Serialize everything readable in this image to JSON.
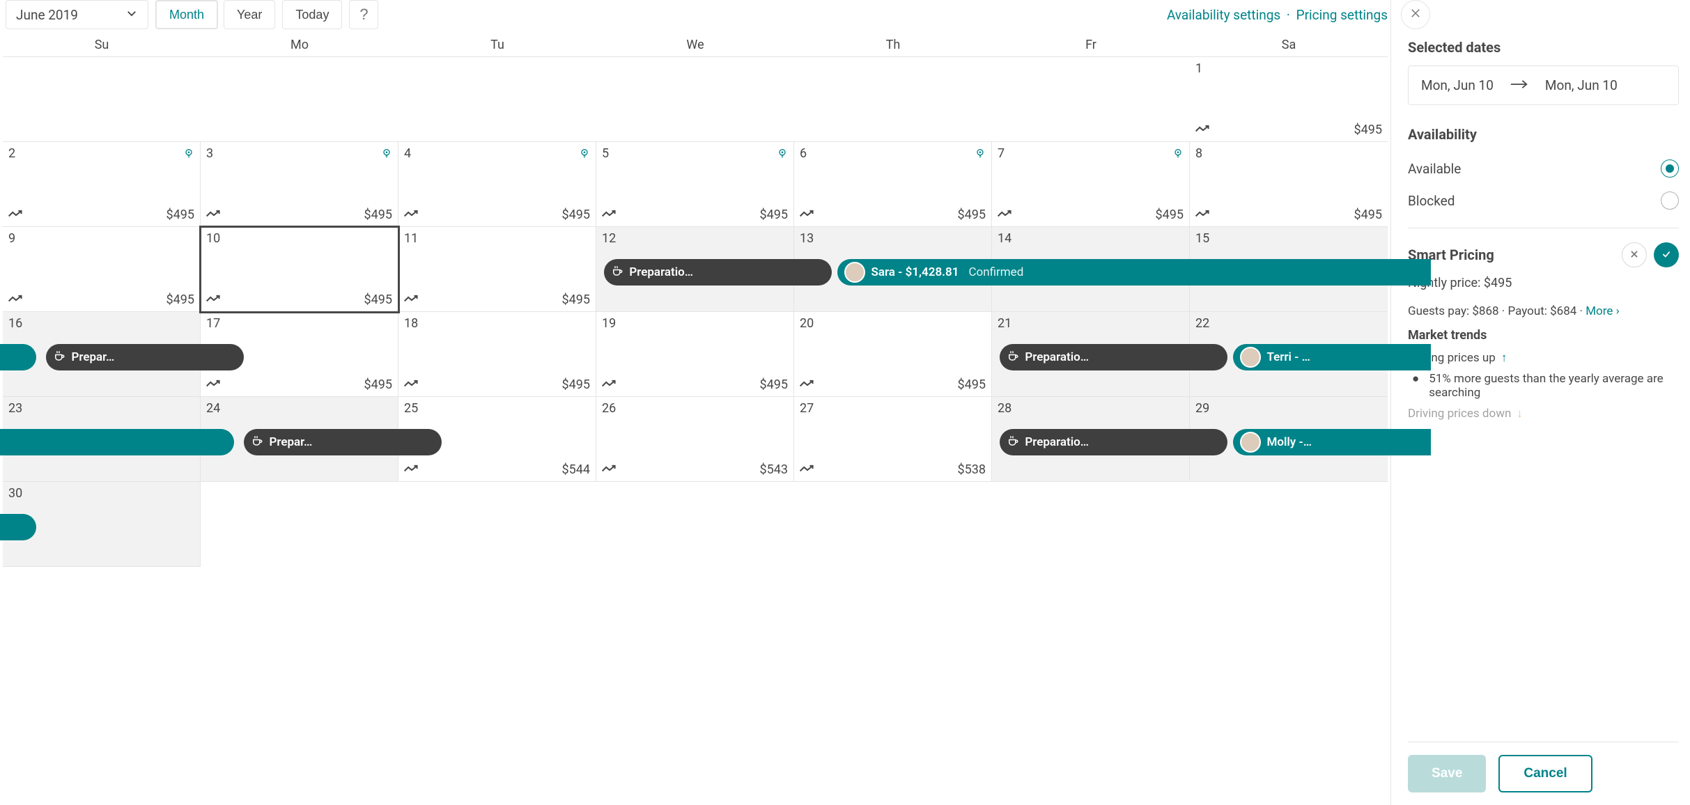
{
  "toolbar": {
    "month_label": "June 2019",
    "view_month": "Month",
    "view_year": "Year",
    "today": "Today",
    "help": "?",
    "availability_link": "Availability settings",
    "pricing_link": "Pricing settings"
  },
  "weekdays": [
    "Su",
    "Mo",
    "Tu",
    "We",
    "Th",
    "Fr",
    "Sa"
  ],
  "cells": [
    {
      "day": "",
      "empty": true
    },
    {
      "day": "",
      "empty": true
    },
    {
      "day": "",
      "empty": true
    },
    {
      "day": "",
      "empty": true
    },
    {
      "day": "",
      "empty": true
    },
    {
      "day": "",
      "empty": true
    },
    {
      "day": "1",
      "price": "$495",
      "trend": true
    },
    {
      "day": "2",
      "price": "$495",
      "smart": true,
      "trend": true
    },
    {
      "day": "3",
      "price": "$495",
      "smart": true,
      "trend": true
    },
    {
      "day": "4",
      "price": "$495",
      "smart": true,
      "trend": true
    },
    {
      "day": "5",
      "price": "$495",
      "smart": true,
      "trend": true
    },
    {
      "day": "6",
      "price": "$495",
      "smart": true,
      "trend": true
    },
    {
      "day": "7",
      "price": "$495",
      "smart": true,
      "trend": true
    },
    {
      "day": "8",
      "price": "$495",
      "trend": true
    },
    {
      "day": "9",
      "price": "$495",
      "trend": true
    },
    {
      "day": "10",
      "price": "$495",
      "selected": true,
      "trend": true
    },
    {
      "day": "11",
      "price": "$495",
      "trend": true
    },
    {
      "day": "12",
      "grey": true
    },
    {
      "day": "13",
      "grey": true
    },
    {
      "day": "14",
      "grey": true
    },
    {
      "day": "15",
      "grey": true
    },
    {
      "day": "16",
      "grey": true
    },
    {
      "day": "17",
      "price": "$495",
      "trend": true
    },
    {
      "day": "18",
      "price": "$495",
      "trend": true
    },
    {
      "day": "19",
      "price": "$495",
      "trend": true
    },
    {
      "day": "20",
      "price": "$495",
      "trend": true
    },
    {
      "day": "21",
      "grey": true
    },
    {
      "day": "22",
      "grey": true
    },
    {
      "day": "23",
      "grey": true
    },
    {
      "day": "24",
      "grey": true
    },
    {
      "day": "25",
      "price": "$544",
      "trend": true
    },
    {
      "day": "26",
      "price": "$543",
      "trend": true
    },
    {
      "day": "27",
      "price": "$538",
      "trend": true
    },
    {
      "day": "28",
      "grey": true
    },
    {
      "day": "29",
      "grey": true
    },
    {
      "day": "30",
      "grey": true
    }
  ],
  "pills": [
    {
      "type": "dark",
      "label": "Preparatio…",
      "row": 2,
      "col_start": 3,
      "col_span": 1.15,
      "offset": 0.04
    },
    {
      "type": "teal",
      "label": "Sara - $1,428.81",
      "secondary": "Confirmed",
      "avatar": true,
      "row": 2,
      "col_start": 4,
      "col_span": 3,
      "offset": 0.22,
      "openend": true
    },
    {
      "type": "teal",
      "label": "",
      "row": 3,
      "col_start": 0,
      "col_span": 0.22,
      "offset": -0.05,
      "openstart": true
    },
    {
      "type": "dark",
      "label": "Prepar…",
      "row": 3,
      "col_start": 0,
      "col_span": 1.0,
      "offset": 0.22
    },
    {
      "type": "dark",
      "label": "Preparatio…",
      "row": 3,
      "col_start": 5,
      "col_span": 1.15,
      "offset": 0.04
    },
    {
      "type": "teal",
      "label": "Terri - …",
      "avatar": true,
      "row": 3,
      "col_start": 6,
      "col_span": 1,
      "offset": 0.22,
      "openend": true
    },
    {
      "type": "teal",
      "label": "",
      "row": 4,
      "col_start": 0,
      "col_span": 1.22,
      "offset": -0.05,
      "openstart": true
    },
    {
      "type": "dark",
      "label": "Prepar…",
      "row": 4,
      "col_start": 1,
      "col_span": 1.0,
      "offset": 0.22
    },
    {
      "type": "dark",
      "label": "Preparatio…",
      "row": 4,
      "col_start": 5,
      "col_span": 1.15,
      "offset": 0.04
    },
    {
      "type": "teal",
      "label": "Molly -…",
      "avatar": true,
      "row": 4,
      "col_start": 6,
      "col_span": 1,
      "offset": 0.22,
      "openend": true
    },
    {
      "type": "teal",
      "label": "",
      "row": 5,
      "col_start": 0,
      "col_span": 0.22,
      "offset": -0.05,
      "openstart": true
    }
  ],
  "panel": {
    "selected_heading": "Selected dates",
    "date_from": "Mon, Jun 10",
    "date_to": "Mon, Jun 10",
    "availability_heading": "Availability",
    "available_label": "Available",
    "blocked_label": "Blocked",
    "smart_pricing_heading": "Smart Pricing",
    "nightly_price_line": "Nightly price: $495",
    "pay_line_guests": "Guests pay: $868",
    "pay_line_payout": "Payout: $684",
    "more": "More",
    "market_heading": "Market trends",
    "up_line": "Driving prices up",
    "bullet_up": "51% more guests than the yearly average are searching",
    "down_line": "Driving prices down",
    "save": "Save",
    "cancel": "Cancel"
  }
}
